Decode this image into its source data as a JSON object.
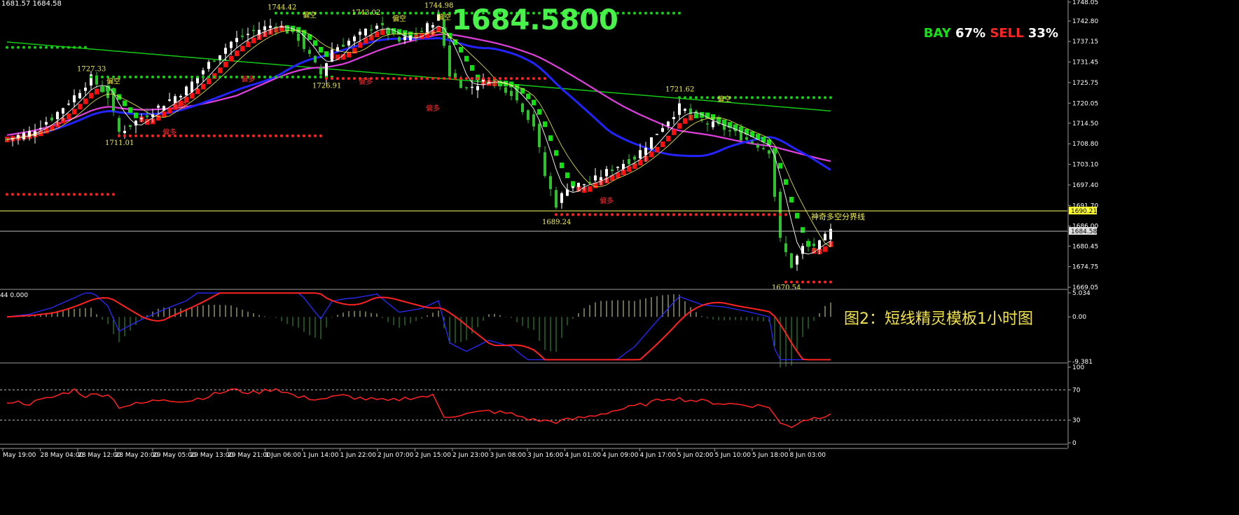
{
  "header": {
    "label": "1681.57 1684.58"
  },
  "big_price": "1684.5800",
  "sentiment": {
    "buy_label": "BAY",
    "buy_pct": "67%",
    "sell_label": "SELL",
    "sell_pct": "33%"
  },
  "caption": "图2：短线精灵模板1小时图",
  "colors": {
    "background": "#000000",
    "bull_candle": "#ffffff",
    "bear_candle": "#2fbf2f",
    "ma_blue": "#2323ff",
    "ma_magenta": "#e040e0",
    "ma_green": "#14c814",
    "step_red": "#ff1010",
    "step_green": "#12e012",
    "dots_green": "#14d014",
    "dots_red": "#ff2020",
    "label_yellow": "#f2f24a",
    "label_red": "#ff3030",
    "level_line": "#ffff66"
  },
  "chart_data": [
    {
      "type": "candlestick",
      "panel": "price",
      "ylim": [
        1669.05,
        1748.05
      ],
      "y_ticks": [
        "1748.05",
        "1742.80",
        "1737.15",
        "1731.45",
        "1725.75",
        "1720.05",
        "1714.50",
        "1708.80",
        "1703.10",
        "1697.40",
        "1691.70",
        "1686.00",
        "1680.45",
        "1674.75",
        "1669.05"
      ],
      "current_price": 1684.58,
      "current_price_tag": "1684.58",
      "level_line": 1690.21,
      "level_line_tag": "1690.21",
      "level_line_label": "神奇多空分界线",
      "x_labels": [
        "May 19:00",
        "28 May 04:00",
        "28 May 12:00",
        "28 May 20:00",
        "29 May 05:00",
        "29 May 13:00",
        "29 May 21:00",
        "1 Jun 06:00",
        "1 Jun 14:00",
        "1 Jun 22:00",
        "2 Jun 07:00",
        "2 Jun 15:00",
        "2 Jun 23:00",
        "3 Jun 08:00",
        "3 Jun 16:00",
        "4 Jun 01:00",
        "4 Jun 09:00",
        "4 Jun 17:00",
        "5 Jun 02:00",
        "5 Jun 10:00",
        "5 Jun 18:00",
        "8 Jun 03:00"
      ],
      "price_labels": [
        {
          "text": "1744.42",
          "bar": 49,
          "price": 1746.0,
          "color": "yellow"
        },
        {
          "text": "1743.02",
          "bar": 64,
          "price": 1744.6,
          "color": "yellow"
        },
        {
          "text": "1744.98",
          "bar": 77,
          "price": 1746.5,
          "color": "yellow"
        },
        {
          "text": "1727.33",
          "bar": 15,
          "price": 1728.9,
          "color": "yellow"
        },
        {
          "text": "1726.91",
          "bar": 57,
          "price": 1724.3,
          "color": "yellow"
        },
        {
          "text": "1711.01",
          "bar": 20,
          "price": 1708.5,
          "color": "yellow"
        },
        {
          "text": "1721.62",
          "bar": 120,
          "price": 1723.3,
          "color": "yellow"
        },
        {
          "text": "1689.24",
          "bar": 98,
          "price": 1686.5,
          "color": "yellow"
        },
        {
          "text": "1670.54",
          "bar": 139,
          "price": 1668.4,
          "color": "yellow"
        }
      ],
      "signal_labels": [
        {
          "text": "偏空",
          "bar": 19,
          "price": 1725.4,
          "color": "yellow"
        },
        {
          "text": "偏空",
          "bar": 54,
          "price": 1743.8,
          "color": "yellow"
        },
        {
          "text": "偏空",
          "bar": 70,
          "price": 1742.8,
          "color": "yellow"
        },
        {
          "text": "偏空",
          "bar": 78,
          "price": 1743.2,
          "color": "yellow"
        },
        {
          "text": "偏空",
          "bar": 128,
          "price": 1720.5,
          "color": "yellow"
        },
        {
          "text": "偏多",
          "bar": 31,
          "price": 1718.6,
          "color": "red"
        },
        {
          "text": "偏多",
          "bar": 29,
          "price": 1711.4,
          "color": "red"
        },
        {
          "text": "偏多",
          "bar": 43,
          "price": 1726.0,
          "color": "red"
        },
        {
          "text": "偏多",
          "bar": 64,
          "price": 1725.3,
          "color": "red"
        },
        {
          "text": "偏多",
          "bar": 76,
          "price": 1718.0,
          "color": "red"
        },
        {
          "text": "偏多",
          "bar": 107,
          "price": 1692.3,
          "color": "red"
        }
      ],
      "dot_lines": [
        {
          "color": "green",
          "price": 1735.5,
          "from": 0,
          "to": 14
        },
        {
          "color": "green",
          "price": 1727.3,
          "from": 15,
          "to": 58
        },
        {
          "color": "green",
          "price": 1745.0,
          "from": 48,
          "to": 120
        },
        {
          "color": "green",
          "price": 1721.6,
          "from": 120,
          "to": 147
        },
        {
          "color": "red",
          "price": 1711.0,
          "from": 20,
          "to": 56
        },
        {
          "color": "red",
          "price": 1694.8,
          "from": 0,
          "to": 19
        },
        {
          "color": "red",
          "price": 1726.9,
          "from": 57,
          "to": 96
        },
        {
          "color": "red",
          "price": 1689.2,
          "from": 98,
          "to": 139
        },
        {
          "color": "red",
          "price": 1670.5,
          "from": 139,
          "to": 147
        }
      ],
      "close_path": [
        [
          0,
          1710
        ],
        [
          4,
          1712
        ],
        [
          8,
          1716
        ],
        [
          12,
          1722
        ],
        [
          15,
          1727
        ],
        [
          18,
          1722
        ],
        [
          20,
          1712
        ],
        [
          24,
          1716
        ],
        [
          28,
          1720
        ],
        [
          32,
          1724
        ],
        [
          36,
          1731
        ],
        [
          40,
          1737
        ],
        [
          44,
          1740
        ],
        [
          48,
          1742
        ],
        [
          52,
          1738
        ],
        [
          56,
          1728
        ],
        [
          58,
          1735
        ],
        [
          62,
          1738
        ],
        [
          66,
          1742
        ],
        [
          70,
          1737
        ],
        [
          74,
          1740
        ],
        [
          77,
          1744
        ],
        [
          79,
          1728
        ],
        [
          82,
          1724
        ],
        [
          86,
          1727
        ],
        [
          90,
          1723
        ],
        [
          94,
          1714
        ],
        [
          96,
          1700
        ],
        [
          98,
          1692
        ],
        [
          100,
          1697
        ],
        [
          104,
          1698
        ],
        [
          108,
          1702
        ],
        [
          112,
          1705
        ],
        [
          116,
          1712
        ],
        [
          120,
          1719
        ],
        [
          124,
          1715
        ],
        [
          128,
          1713
        ],
        [
          132,
          1710
        ],
        [
          136,
          1707
        ],
        [
          138,
          1682
        ],
        [
          140,
          1675
        ],
        [
          142,
          1680
        ],
        [
          145,
          1681
        ],
        [
          147,
          1684.6
        ]
      ],
      "indicators": [
        "MA fast",
        "MA slow blue",
        "MA slow magenta",
        "MA long green",
        "step line red/green"
      ]
    },
    {
      "type": "histogram+line",
      "panel": "macd",
      "label": "44 0.000",
      "y_ticks": [
        "5.034",
        "0.00",
        "-9.381"
      ],
      "ylim": [
        -9.381,
        5.034
      ]
    },
    {
      "type": "line",
      "panel": "oscillator",
      "y_ticks": [
        "100",
        "70",
        "30",
        "0"
      ],
      "ylim": [
        0,
        100
      ],
      "levels": [
        70,
        30
      ],
      "path": [
        [
          0,
          55
        ],
        [
          4,
          52
        ],
        [
          8,
          60
        ],
        [
          12,
          70
        ],
        [
          14,
          62
        ],
        [
          18,
          65
        ],
        [
          20,
          48
        ],
        [
          24,
          52
        ],
        [
          28,
          58
        ],
        [
          32,
          55
        ],
        [
          36,
          62
        ],
        [
          40,
          70
        ],
        [
          44,
          66
        ],
        [
          48,
          72
        ],
        [
          52,
          60
        ],
        [
          56,
          58
        ],
        [
          60,
          62
        ],
        [
          64,
          58
        ],
        [
          68,
          55
        ],
        [
          72,
          60
        ],
        [
          76,
          62
        ],
        [
          78,
          35
        ],
        [
          82,
          38
        ],
        [
          86,
          42
        ],
        [
          90,
          38
        ],
        [
          94,
          30
        ],
        [
          98,
          28
        ],
        [
          100,
          30
        ],
        [
          104,
          35
        ],
        [
          108,
          42
        ],
        [
          112,
          48
        ],
        [
          116,
          55
        ],
        [
          118,
          60
        ],
        [
          120,
          58
        ],
        [
          124,
          55
        ],
        [
          128,
          52
        ],
        [
          132,
          50
        ],
        [
          136,
          48
        ],
        [
          138,
          25
        ],
        [
          140,
          22
        ],
        [
          142,
          30
        ],
        [
          145,
          34
        ],
        [
          147,
          40
        ]
      ]
    }
  ]
}
